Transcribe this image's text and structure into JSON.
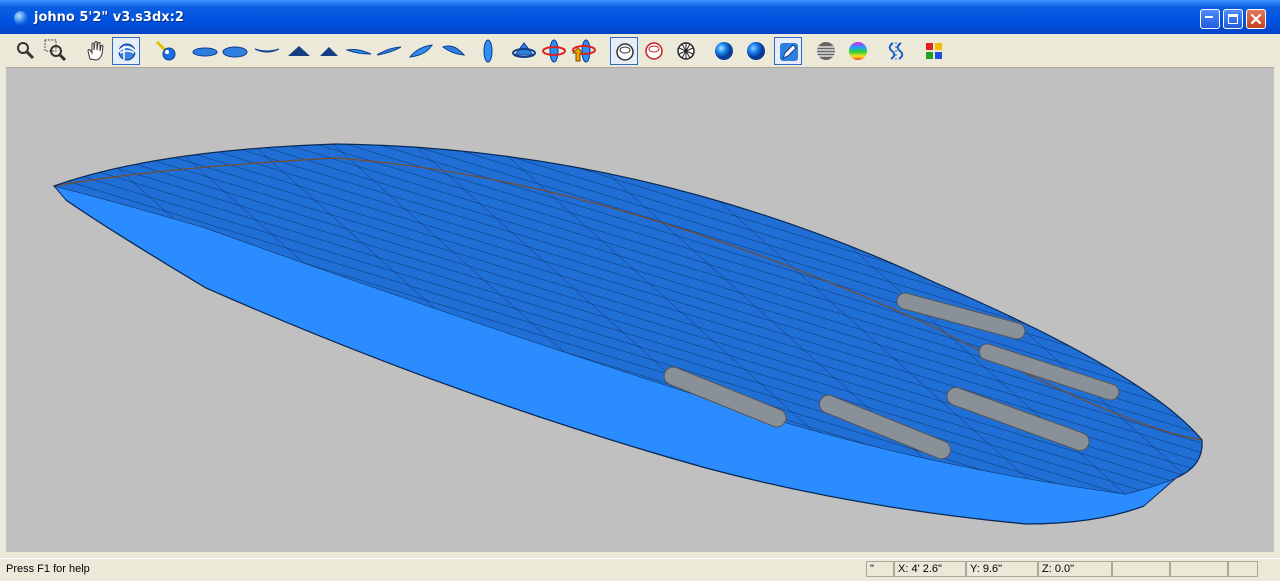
{
  "window": {
    "title": "johno 5'2\" v3.s3dx:2",
    "controls": {
      "minimize": "minimize",
      "maximize": "maximize",
      "close": "close"
    }
  },
  "toolbar": {
    "tools": [
      {
        "name": "zoom-icon",
        "active": false
      },
      {
        "name": "zoom-window-icon",
        "active": false
      },
      {
        "name": "pan-hand-icon",
        "active": false
      },
      {
        "name": "rotate-view-icon",
        "active": true
      },
      {
        "name": "light-source-icon",
        "active": false
      },
      {
        "name": "view-bottom-icon",
        "active": false
      },
      {
        "name": "view-deck-icon",
        "active": false
      },
      {
        "name": "view-rocker-icon",
        "active": false
      },
      {
        "name": "view-front-icon",
        "active": false
      },
      {
        "name": "view-back-icon",
        "active": false
      },
      {
        "name": "view-iso-1-icon",
        "active": false
      },
      {
        "name": "view-iso-2-icon",
        "active": false
      },
      {
        "name": "view-iso-3-icon",
        "active": false
      },
      {
        "name": "view-iso-4-icon",
        "active": false
      },
      {
        "name": "view-side-icon",
        "active": false
      },
      {
        "name": "rotate-x-icon",
        "active": false
      },
      {
        "name": "rotate-y-icon",
        "active": false
      },
      {
        "name": "rotate-z-icon",
        "active": false
      },
      {
        "name": "shade-outline-icon",
        "active": true
      },
      {
        "name": "shade-red-outline-icon",
        "active": false
      },
      {
        "name": "wireframe-icon",
        "active": false
      },
      {
        "name": "shaded-sphere-icon",
        "active": false
      },
      {
        "name": "shaded-sphere-2-icon",
        "active": false
      },
      {
        "name": "pen-edit-icon",
        "active": true
      },
      {
        "name": "stripes-icon",
        "active": false
      },
      {
        "name": "rainbow-sphere-icon",
        "active": false
      },
      {
        "name": "curvature-icon",
        "active": false
      },
      {
        "name": "color-palette-icon",
        "active": false
      }
    ]
  },
  "colors": {
    "titlebar": "#0053e1",
    "board": "#1f6fd6",
    "rail": "#2b8cff",
    "viewport": "#c0c0c0"
  },
  "statusbar": {
    "help": "Press F1 for help",
    "unit": "\"",
    "x": "X: 4' 2.6\"",
    "y": "Y: 9.6\"",
    "z": "Z: 0.0\""
  }
}
